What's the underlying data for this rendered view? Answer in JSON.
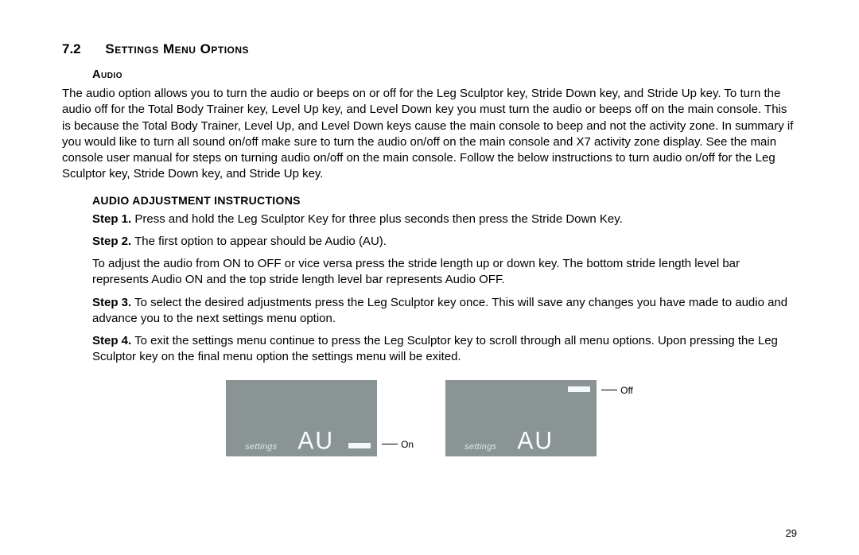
{
  "section": {
    "num": "7.2",
    "title": "Settings Menu Options"
  },
  "audio": {
    "heading": "Audio",
    "paragraph": "The audio option allows you to turn the audio or beeps on or off for the Leg Sculptor key, Stride Down key, and Stride Up key. To turn the audio off for the Total Body Trainer key, Level Up key, and Level Down key you must turn the audio or beeps off on the main console. This is because the Total Body Trainer, Level Up, and Level Down keys cause the main console to beep and not the activity zone. In summary if you would like to turn all sound on/off make sure to turn the audio on/off on the main console and X7 activity zone display. See the main console user manual for steps on turning audio on/off on the main console. Follow the below instructions to turn audio on/off for the Leg Sculptor key, Stride Down key, and Stride Up key."
  },
  "instructions": {
    "heading": "AUDIO ADJUSTMENT INSTRUCTIONS",
    "steps": [
      {
        "label": "Step 1.",
        "text": " Press and hold the Leg Sculptor Key for three plus seconds then press the Stride Down Key."
      },
      {
        "label": "Step 2.",
        "text": " The first option to appear should be Audio (AU)."
      },
      {
        "label": "",
        "text": "To adjust the audio from ON to OFF or vice versa press the stride length up or down key. The bottom stride length level bar represents Audio ON and the top stride length level bar represents Audio OFF."
      },
      {
        "label": "Step 3.",
        "text": " To select the desired adjustments press the Leg Sculptor key once.  This will save any changes you have made to audio and advance you to the next settings menu option."
      },
      {
        "label": "Step 4.",
        "text": " To exit the settings menu continue to press the Leg Sculptor key to scroll through all menu options. Upon pressing the Leg Sculptor key on the final menu option the settings menu will be exited."
      }
    ]
  },
  "figure": {
    "settings_label": "settings",
    "segment": "AU",
    "on_label": "On",
    "off_label": "Off"
  },
  "page_number": "29"
}
